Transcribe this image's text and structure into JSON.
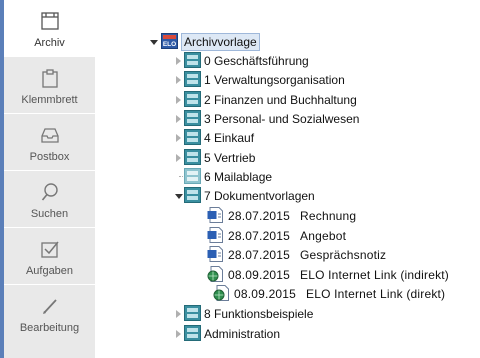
{
  "sidebar": {
    "items": [
      {
        "label": "Archiv",
        "icon": "archive-icon",
        "active": true
      },
      {
        "label": "Klemmbrett",
        "icon": "clipboard-icon",
        "active": false
      },
      {
        "label": "Postbox",
        "icon": "inbox-icon",
        "active": false
      },
      {
        "label": "Suchen",
        "icon": "search-icon",
        "active": false
      },
      {
        "label": "Aufgaben",
        "icon": "task-check-icon",
        "active": false
      },
      {
        "label": "Bearbeitung",
        "icon": "pencil-icon",
        "active": false
      }
    ]
  },
  "tree": {
    "root": {
      "label": "Archivvorlage",
      "icon": "elo-archive-icon",
      "expanded": true
    },
    "folders": [
      {
        "label": "0 Geschäftsführung",
        "icon": "cabinet-icon",
        "expanded": false
      },
      {
        "label": "1 Verwaltungsorganisation",
        "icon": "cabinet-icon",
        "expanded": false
      },
      {
        "label": "2 Finanzen und Buchhaltung",
        "icon": "cabinet-icon",
        "expanded": false
      },
      {
        "label": "3 Personal- und Sozialwesen",
        "icon": "cabinet-icon",
        "expanded": false
      },
      {
        "label": "4 Einkauf",
        "icon": "cabinet-icon",
        "expanded": false
      },
      {
        "label": "5 Vertrieb",
        "icon": "cabinet-icon",
        "expanded": false
      },
      {
        "label": "6 Mailablage",
        "icon": "cabinet-icon",
        "expanded": false
      },
      {
        "label": "7 Dokumentvorlagen",
        "icon": "cabinet-icon",
        "expanded": true
      },
      {
        "label": "8 Funktionsbeispiele",
        "icon": "cabinet-icon",
        "expanded": false
      },
      {
        "label": "Administration",
        "icon": "cabinet-icon",
        "expanded": false
      }
    ],
    "documents": [
      {
        "date": "28.07.2015",
        "name": "Rechnung",
        "icon": "word-document-icon"
      },
      {
        "date": "28.07.2015",
        "name": "Angebot",
        "icon": "word-document-icon"
      },
      {
        "date": "28.07.2015",
        "name": "Gesprächsnotiz",
        "icon": "word-document-icon"
      },
      {
        "date": "08.09.2015",
        "name": "ELO Internet Link (indirekt)",
        "icon": "internet-link-document-icon"
      },
      {
        "date": "08.09.2015",
        "name": "ELO Internet Link (direkt)",
        "icon": "internet-link-document-icon"
      }
    ]
  },
  "colors": {
    "sidebar_bg": "#e9e9e9",
    "accent": "#5b7fb9",
    "selection_bg": "#dde8f5",
    "cabinet": "#3a8fa0"
  }
}
